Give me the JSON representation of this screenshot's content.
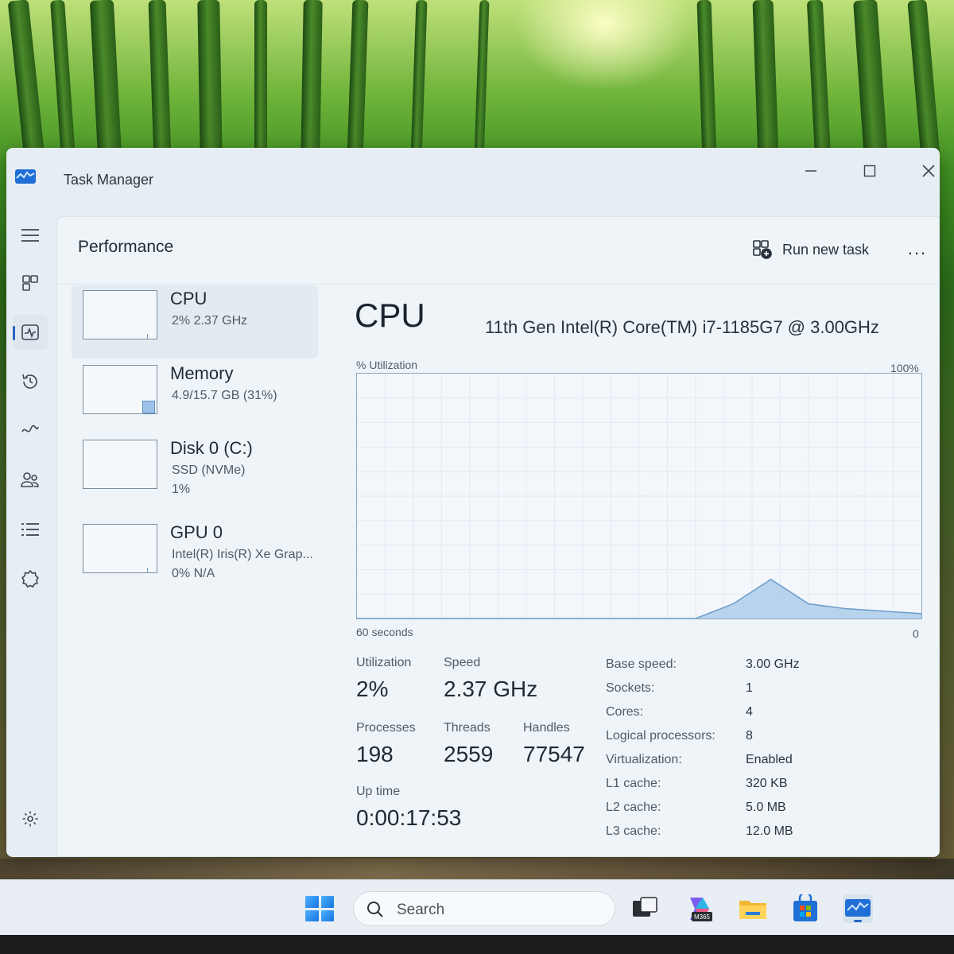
{
  "window": {
    "title": "Task Manager",
    "controls": {
      "minimize": "minimize-icon",
      "maximize": "maximize-icon",
      "close": "close-icon"
    }
  },
  "nav": {
    "items": [
      "menu-icon",
      "processes-icon",
      "performance-icon",
      "app-history-icon",
      "startup-apps-icon",
      "users-icon",
      "details-icon",
      "services-icon"
    ],
    "active": "performance-icon",
    "settings": "settings-icon"
  },
  "header": {
    "title": "Performance",
    "run_new_task": "Run new task",
    "more": "..."
  },
  "devices": [
    {
      "name": "CPU",
      "sub1": "2%  2.37 GHz"
    },
    {
      "name": "Memory",
      "sub1": "4.9/15.7 GB (31%)"
    },
    {
      "name": "Disk 0 (C:)",
      "sub1": "SSD (NVMe)",
      "sub2": "1%"
    },
    {
      "name": "GPU 0",
      "sub1": "Intel(R) Iris(R) Xe Grap...",
      "sub2": "0%  N/A"
    }
  ],
  "detail": {
    "title": "CPU",
    "model": "11th Gen Intel(R) Core(TM) i7-1185G7 @ 3.00GHz",
    "util_label": "% Utilization",
    "util_max": "100%",
    "time_left": "60 seconds",
    "time_right": "0",
    "stats": {
      "utilization_label": "Utilization",
      "utilization": "2%",
      "speed_label": "Speed",
      "speed": "2.37 GHz",
      "processes_label": "Processes",
      "processes": "198",
      "threads_label": "Threads",
      "threads": "2559",
      "handles_label": "Handles",
      "handles": "77547",
      "uptime_label": "Up time",
      "uptime": "0:00:17:53"
    },
    "specs": [
      {
        "k": "Base speed:",
        "v": "3.00 GHz"
      },
      {
        "k": "Sockets:",
        "v": "1"
      },
      {
        "k": "Cores:",
        "v": "4"
      },
      {
        "k": "Logical processors:",
        "v": "8"
      },
      {
        "k": "Virtualization:",
        "v": "Enabled"
      },
      {
        "k": "L1 cache:",
        "v": "320 KB"
      },
      {
        "k": "L2 cache:",
        "v": "5.0 MB"
      },
      {
        "k": "L3 cache:",
        "v": "12.0 MB"
      }
    ]
  },
  "chart_data": {
    "type": "area",
    "ylim": [
      0,
      100
    ],
    "x": [
      0,
      1,
      2,
      3,
      4,
      5,
      6,
      7,
      8,
      9,
      10,
      11,
      12,
      13,
      14,
      15
    ],
    "values": [
      0,
      0,
      0,
      0,
      0,
      0,
      0,
      0,
      0,
      0,
      6,
      16,
      6,
      4,
      3,
      2
    ]
  },
  "taskbar": {
    "search": "Search",
    "apps": [
      "start-icon",
      "task-view-icon",
      "microsoft-365-icon",
      "file-explorer-icon",
      "store-icon",
      "task-manager-icon"
    ],
    "m365_label": "M365"
  },
  "colors": {
    "accent": "#2a63c4",
    "graph_line": "#6c9acb",
    "graph_fill": "#a9cbea"
  }
}
